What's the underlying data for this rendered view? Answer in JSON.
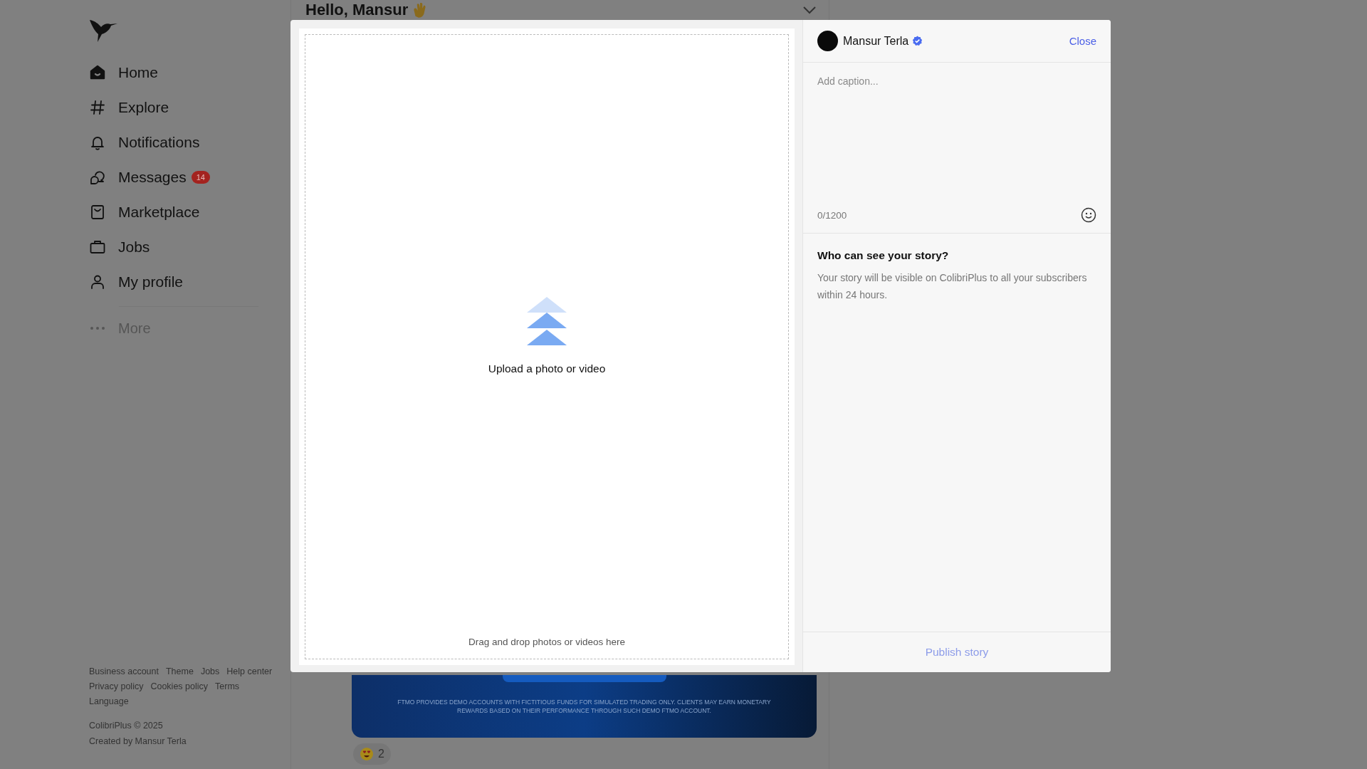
{
  "sidebar": {
    "nav": [
      {
        "label": "Home",
        "kind": "home",
        "selected": true
      },
      {
        "label": "Explore",
        "kind": "hash",
        "selected": false
      },
      {
        "label": "Notifications",
        "kind": "bell",
        "selected": false
      },
      {
        "label": "Messages",
        "kind": "chat",
        "selected": false,
        "badge": "14"
      },
      {
        "label": "Marketplace",
        "kind": "bag",
        "selected": false
      },
      {
        "label": "Jobs",
        "kind": "briefcase",
        "selected": false
      },
      {
        "label": "My profile",
        "kind": "person",
        "selected": false
      }
    ],
    "more": "More",
    "footer_links": [
      "Business account",
      "Theme",
      "Jobs",
      "Help center",
      "Privacy policy",
      "Cookies policy",
      "Terms",
      "Language"
    ],
    "copyright": "ColibriPlus © 2025",
    "credit": "Created by Mansur Terla"
  },
  "feed": {
    "greeting": "Hello, Mansur",
    "ad_disclaimer": "FTMO PROVIDES DEMO ACCOUNTS WITH FICTITIOUS FUNDS FOR SIMULATED TRADING ONLY. CLIENTS MAY EARN MONETARY REWARDS BASED ON THEIR PERFORMANCE THROUGH SUCH DEMO FTMO ACCOUNT.",
    "reactions": [
      {
        "count": "2"
      }
    ]
  },
  "story_modal": {
    "upload_title": "Upload a photo or video",
    "drop_hint": "Drag and drop photos or videos here",
    "author": {
      "name": "Mansur Terla",
      "verified": true
    },
    "close": "Close",
    "caption": {
      "placeholder": "Add caption...",
      "counter": "0/1200"
    },
    "visibility": {
      "title": "Who can see your story?",
      "text": "Your story will be visible on ColibriPlus to all your subscribers within 24 hours."
    },
    "publish": {
      "label": "Publish story",
      "disabled": true
    }
  }
}
